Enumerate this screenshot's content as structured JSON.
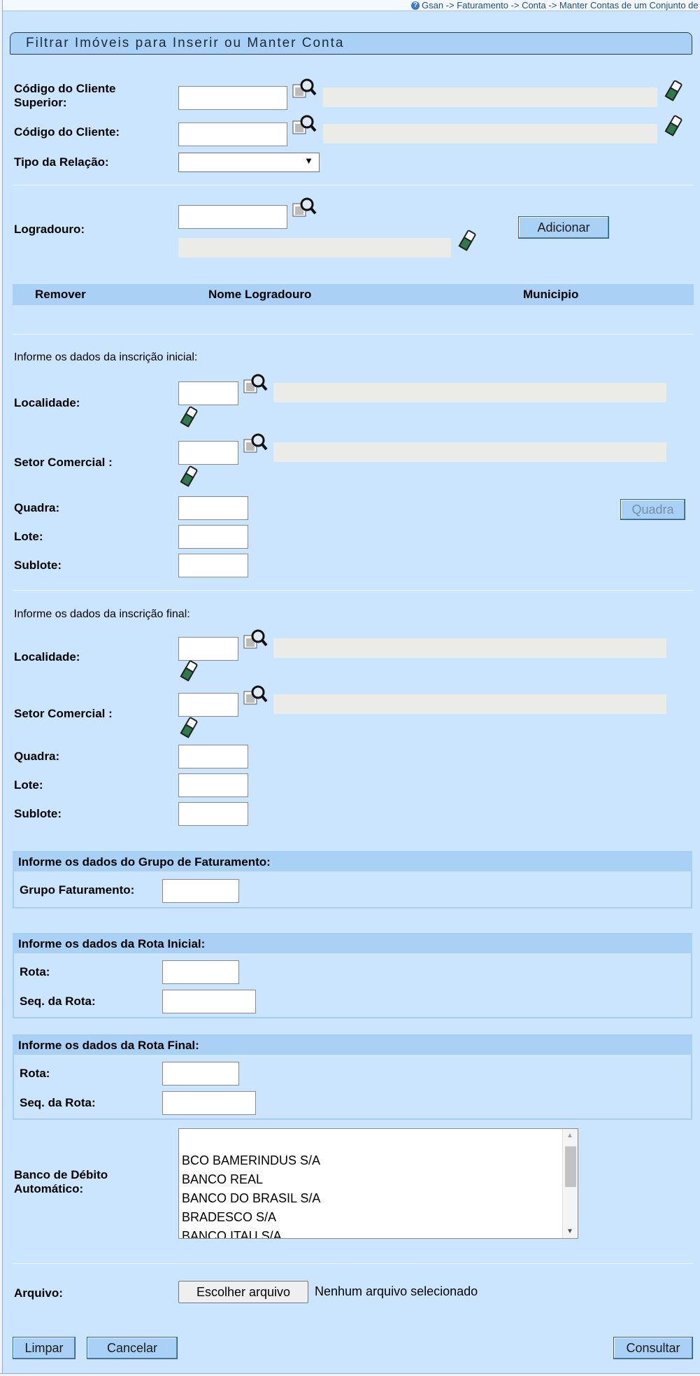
{
  "breadcrumb": "Gsan -> Faturamento -> Conta -> Manter Contas de um Conjunto de Imoveis",
  "title": "Filtrar Imóveis para Inserir ou Manter Conta",
  "cliente_superior": {
    "label": "Código do Cliente Superior:",
    "value": "",
    "name": ""
  },
  "cliente": {
    "label": "Código do Cliente:",
    "value": "",
    "name": ""
  },
  "tipo_relacao": {
    "label": "Tipo da Relação:",
    "selected": ""
  },
  "logradouro": {
    "label": "Logradouro:",
    "value": "",
    "name": "",
    "add_button": "Adicionar",
    "table_headers": [
      "Remover",
      "Nome Logradouro",
      "Municipio"
    ]
  },
  "inscricao_inicial": {
    "heading": "Informe os dados da inscrição inicial:",
    "localidade_label": "Localidade:",
    "setor_label": "Setor Comercial :",
    "quadra_label": "Quadra:",
    "lote_label": "Lote:",
    "sublote_label": "Sublote:",
    "quadra_button": "Quadra"
  },
  "inscricao_final": {
    "heading": "Informe os dados da inscrição final:",
    "localidade_label": "Localidade:",
    "setor_label": "Setor Comercial :",
    "quadra_label": "Quadra:",
    "lote_label": "Lote:",
    "sublote_label": "Sublote:"
  },
  "grupo_faturamento": {
    "heading": "Informe os dados do Grupo de Faturamento:",
    "label": "Grupo Faturamento:"
  },
  "rota_inicial": {
    "heading": "Informe os dados da Rota Inicial:",
    "rota_label": "Rota:",
    "seq_label": "Seq. da Rota:"
  },
  "rota_final": {
    "heading": "Informe os dados da Rota Final:",
    "rota_label": "Rota:",
    "seq_label": "Seq. da Rota:"
  },
  "banco": {
    "label": "Banco de Débito Automático:",
    "options": [
      "BCO BAMERINDUS S/A",
      "BANCO REAL",
      "BANCO DO BRASIL S/A",
      "BRADESCO S/A",
      "BANCO ITAU S/A"
    ]
  },
  "arquivo": {
    "label": "Arquivo:",
    "button": "Escolher arquivo",
    "status": "Nenhum arquivo selecionado"
  },
  "actions": {
    "limpar": "Limpar",
    "cancelar": "Cancelar",
    "consultar": "Consultar"
  },
  "icons": {
    "search": "magnifier-icon",
    "clear": "eraser-icon",
    "help": "help-icon"
  }
}
